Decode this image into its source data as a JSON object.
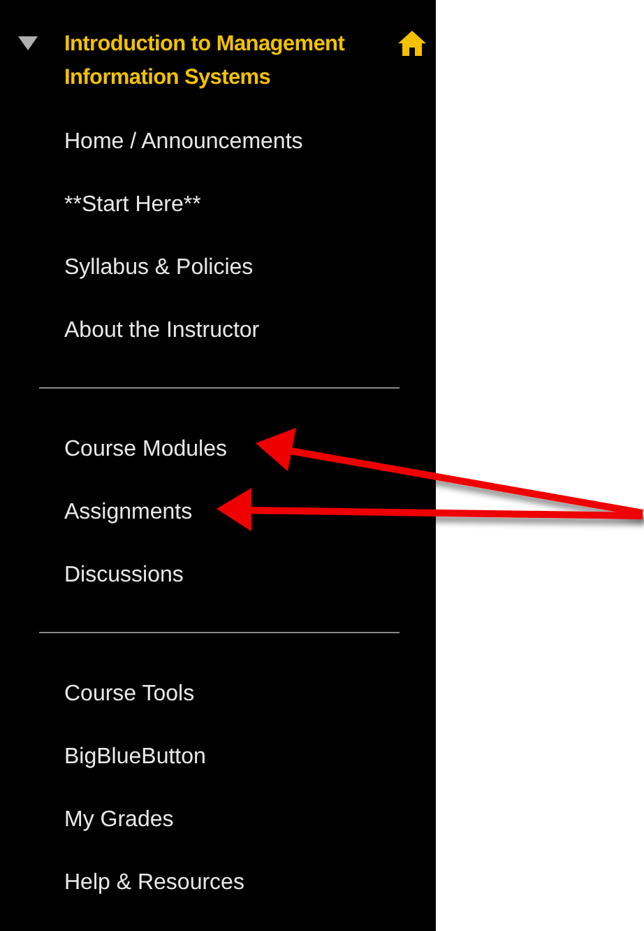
{
  "course_menu": {
    "title": "Introduction to Management Information Systems",
    "expanded": true,
    "groups": [
      {
        "items": [
          "Home / Announcements",
          "**Start Here**",
          "Syllabus & Policies",
          "About the Instructor"
        ]
      },
      {
        "items": [
          "Course Modules",
          "Assignments",
          "Discussions"
        ]
      },
      {
        "items": [
          "Course Tools",
          "BigBlueButton",
          "My Grades",
          "Help & Resources"
        ]
      }
    ]
  }
}
